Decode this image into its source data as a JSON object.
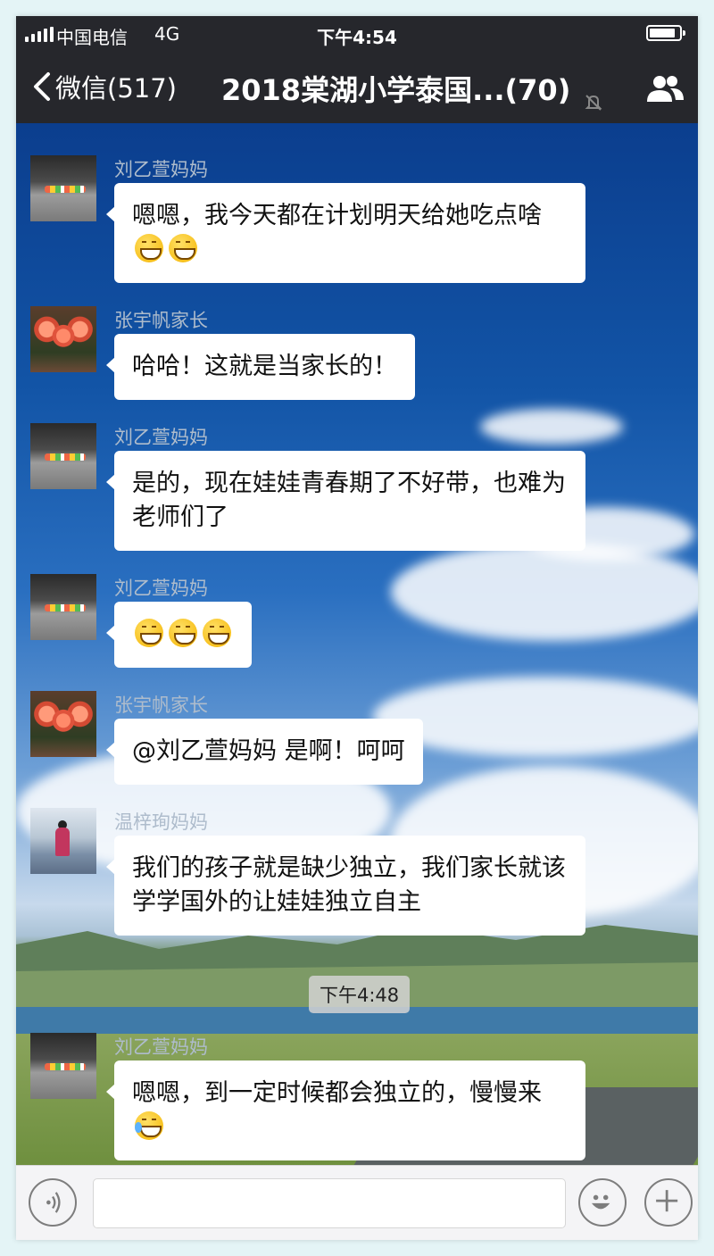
{
  "status_bar": {
    "carrier": "中国电信",
    "network": "4G",
    "time": "下午4:54"
  },
  "nav": {
    "back_label": "微信(517)",
    "title": "2018棠湖小学泰国...(70)",
    "icons": [
      "chevron-left-icon",
      "mute-icon",
      "members-icon"
    ]
  },
  "messages": [
    {
      "sender": "刘乙萱妈妈",
      "text": "嗯嗯，我今天都在计划明天给她吃点啥",
      "emoji_count": 2,
      "avatar": "car-dashboard"
    },
    {
      "sender": "张宇帆家长",
      "text": "哈哈！这就是当家长的！",
      "emoji_count": 0,
      "avatar": "roses"
    },
    {
      "sender": "刘乙萱妈妈",
      "text": "是的，现在娃娃青春期了不好带，也难为老师们了",
      "emoji_count": 0,
      "avatar": "car-dashboard"
    },
    {
      "sender": "刘乙萱妈妈",
      "text": "",
      "emoji_count": 3,
      "avatar": "car-dashboard"
    },
    {
      "sender": "张宇帆家长",
      "text": "@刘乙萱妈妈 是啊！呵呵",
      "emoji_count": 0,
      "avatar": "roses"
    },
    {
      "sender": "温梓珣妈妈",
      "text": "我们的孩子就是缺少独立，我们家长就该学学国外的让娃娃独立自主",
      "emoji_count": 0,
      "avatar": "girl-beach"
    },
    {
      "sender": "刘乙萱妈妈",
      "text": "嗯嗯，到一定时候都会独立的，慢慢来",
      "emoji_count": 1,
      "avatar": "car-dashboard"
    }
  ],
  "timestamp": "下午4:48",
  "input_bar": {
    "placeholder": "",
    "icons": [
      "voice-icon",
      "emoji-icon",
      "plus-icon"
    ]
  },
  "colors": {
    "topbar": "#26272c",
    "bubble": "#ffffff",
    "sender_name": "#aebccc",
    "page_bg": "#e4f4f6"
  }
}
